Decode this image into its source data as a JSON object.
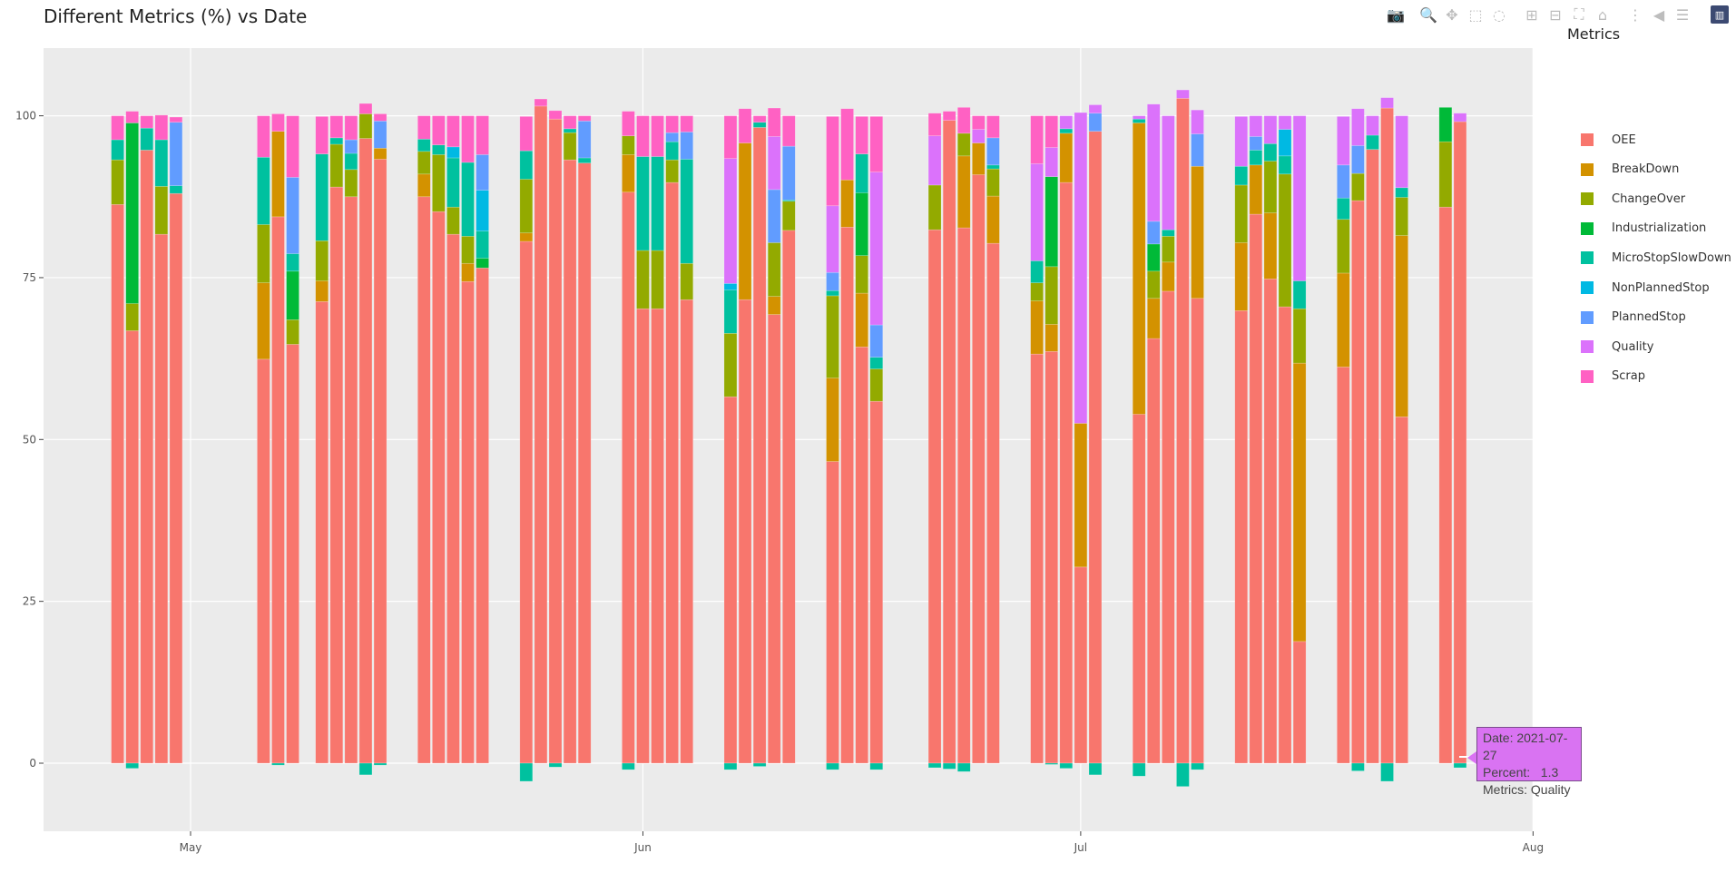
{
  "title": "Different Metrics (%) vs Date",
  "modebar": {
    "buttons": [
      {
        "icon": "camera-icon",
        "label": "Download plot as a png",
        "glyph": "📷"
      },
      {
        "icon": "zoom-icon",
        "label": "Zoom",
        "glyph": "🔍",
        "active": true
      },
      {
        "icon": "pan-icon",
        "label": "Pan",
        "glyph": "✥"
      },
      {
        "icon": "box-select-icon",
        "label": "Box Select",
        "glyph": "⬚"
      },
      {
        "icon": "lasso-select-icon",
        "label": "Lasso Select",
        "glyph": "◌"
      },
      {
        "icon": "zoom-in-icon",
        "label": "Zoom in",
        "glyph": "⊞"
      },
      {
        "icon": "zoom-out-icon",
        "label": "Zoom out",
        "glyph": "⊟"
      },
      {
        "icon": "autoscale-icon",
        "label": "Autoscale",
        "glyph": "⛶"
      },
      {
        "icon": "home-icon",
        "label": "Reset axes",
        "glyph": "⌂"
      },
      {
        "icon": "spike-lines-icon",
        "label": "Toggle Spike Lines",
        "glyph": "⋮"
      },
      {
        "icon": "hover-closest-icon",
        "label": "Show closest data on hover",
        "glyph": "◀"
      },
      {
        "icon": "hover-compare-icon",
        "label": "Compare data on hover",
        "glyph": "☰"
      }
    ],
    "logo": "plotly-logo-icon"
  },
  "tooltip": {
    "date_line": "Date: 2021-07-27",
    "percent_line": "Percent:   1.3",
    "metrics_line": "Metrics: Quality",
    "color": "#d973f2"
  },
  "chart_data": {
    "type": "bar",
    "barmode": "stacked",
    "title": "Different Metrics (%) vs Date",
    "xlabel": "",
    "ylabel": "",
    "x_range": [
      "2021-04-23",
      "2021-08-01"
    ],
    "ylim": [
      -10.5,
      110
    ],
    "x_ticks": [
      {
        "label": "May",
        "date": "2021-05-01"
      },
      {
        "label": "Jun",
        "date": "2021-06-01"
      },
      {
        "label": "Jul",
        "date": "2021-07-01"
      },
      {
        "label": "Aug",
        "date": "2021-08-01"
      }
    ],
    "y_ticks": [
      0,
      25,
      50,
      75,
      100
    ],
    "grid": true,
    "legend": {
      "title": "Metrics",
      "position": "right"
    },
    "series_order": [
      "OEE",
      "BreakDown",
      "ChangeOver",
      "Industrialization",
      "MicroStopSlowDown",
      "NonPlannedStop",
      "PlannedStop",
      "Quality",
      "Scrap"
    ],
    "colors": {
      "OEE": "#f8766d",
      "BreakDown": "#d39200",
      "ChangeOver": "#93aa00",
      "Industrialization": "#00ba38",
      "MicroStopSlowDown": "#00c19f",
      "NonPlannedStop": "#00b9e3",
      "PlannedStop": "#619cff",
      "Quality": "#db72fb",
      "Scrap": "#ff61c3"
    },
    "bars": [
      {
        "date": "2021-04-26",
        "OEE": 86.3,
        "ChangeOver": 6.9,
        "MicroStopSlowDown": 3.1,
        "Scrap": 3.7
      },
      {
        "date": "2021-04-27",
        "OEE": 66.8,
        "ChangeOver": 4.2,
        "Industrialization": 27.9,
        "Scrap": 1.8,
        "MicroStopSlowDown": -0.8
      },
      {
        "date": "2021-04-28",
        "OEE": 94.7,
        "MicroStopSlowDown": 3.4,
        "Scrap": 1.9
      },
      {
        "date": "2021-04-29",
        "OEE": 81.7,
        "ChangeOver": 7.4,
        "MicroStopSlowDown": 7.2,
        "Scrap": 3.8
      },
      {
        "date": "2021-04-30",
        "OEE": 88.0,
        "MicroStopSlowDown": 1.2,
        "PlannedStop": 9.8,
        "Scrap": 0.8
      },
      {
        "date": "2021-05-06",
        "OEE": 62.4,
        "BreakDown": 11.8,
        "ChangeOver": 9.0,
        "MicroStopSlowDown": 10.4,
        "Scrap": 6.4
      },
      {
        "date": "2021-05-07",
        "OEE": 84.4,
        "BreakDown": 13.2,
        "Scrap": 2.7,
        "MicroStopSlowDown": -0.3
      },
      {
        "date": "2021-05-08",
        "OEE": 64.7,
        "ChangeOver": 3.8,
        "Industrialization": 7.5,
        "MicroStopSlowDown": 2.7,
        "PlannedStop": 11.8,
        "Scrap": 9.5
      },
      {
        "date": "2021-05-10",
        "OEE": 71.3,
        "BreakDown": 3.2,
        "ChangeOver": 6.2,
        "MicroStopSlowDown": 13.4,
        "Scrap": 5.8
      },
      {
        "date": "2021-05-11",
        "OEE": 89.0,
        "ChangeOver": 6.6,
        "MicroStopSlowDown": 1.0,
        "Scrap": 3.4
      },
      {
        "date": "2021-05-12",
        "OEE": 87.5,
        "ChangeOver": 4.2,
        "MicroStopSlowDown": 2.5,
        "PlannedStop": 2.1,
        "Scrap": 3.7
      },
      {
        "date": "2021-05-13",
        "OEE": 96.5,
        "ChangeOver": 3.8,
        "Scrap": 1.6,
        "MicroStopSlowDown": -1.8
      },
      {
        "date": "2021-05-14",
        "OEE": 93.3,
        "BreakDown": 1.7,
        "PlannedStop": 4.2,
        "Scrap": 1.1,
        "MicroStopSlowDown": -0.3
      },
      {
        "date": "2021-05-17",
        "OEE": 87.5,
        "BreakDown": 3.5,
        "ChangeOver": 3.5,
        "MicroStopSlowDown": 1.9,
        "Scrap": 3.6
      },
      {
        "date": "2021-05-18",
        "OEE": 85.2,
        "ChangeOver": 8.8,
        "MicroStopSlowDown": 1.5,
        "Scrap": 4.5
      },
      {
        "date": "2021-05-19",
        "OEE": 81.7,
        "ChangeOver": 4.2,
        "MicroStopSlowDown": 7.6,
        "NonPlannedStop": 1.7,
        "Scrap": 4.8
      },
      {
        "date": "2021-05-20",
        "OEE": 74.4,
        "BreakDown": 2.8,
        "ChangeOver": 4.2,
        "MicroStopSlowDown": 11.4,
        "Scrap": 7.2
      },
      {
        "date": "2021-05-21",
        "OEE": 76.5,
        "Industrialization": 1.5,
        "MicroStopSlowDown": 4.2,
        "NonPlannedStop": 6.3,
        "PlannedStop": 5.5,
        "Scrap": 6.0
      },
      {
        "date": "2021-05-24",
        "OEE": 80.6,
        "BreakDown": 1.3,
        "ChangeOver": 8.3,
        "MicroStopSlowDown": 4.4,
        "Scrap": 5.3,
        "MicroStopSlowDown_neg": -2.8
      },
      {
        "date": "2021-05-25",
        "OEE": 101.5,
        "Scrap": 1.1
      },
      {
        "date": "2021-05-26",
        "OEE": 99.5,
        "Scrap": 1.3,
        "MicroStopSlowDown": -0.6
      },
      {
        "date": "2021-05-27",
        "OEE": 93.2,
        "ChangeOver": 4.2,
        "MicroStopSlowDown": 0.6,
        "Scrap": 2.0
      },
      {
        "date": "2021-05-28",
        "OEE": 92.7,
        "MicroStopSlowDown": 0.8,
        "PlannedStop": 5.7,
        "Scrap": 0.8
      },
      {
        "date": "2021-05-31",
        "OEE": 88.2,
        "BreakDown": 5.8,
        "ChangeOver": 2.9,
        "Scrap": 3.8,
        "MicroStopSlowDown": -1.0
      },
      {
        "date": "2021-06-01",
        "OEE": 70.2,
        "ChangeOver": 9.0,
        "MicroStopSlowDown": 14.5,
        "Scrap": 6.3
      },
      {
        "date": "2021-06-02",
        "OEE": 70.2,
        "ChangeOver": 9.0,
        "MicroStopSlowDown": 14.5,
        "Scrap": 6.3
      },
      {
        "date": "2021-06-03",
        "OEE": 89.7,
        "ChangeOver": 3.5,
        "MicroStopSlowDown": 2.8,
        "PlannedStop": 1.4,
        "Scrap": 2.6
      },
      {
        "date": "2021-06-04",
        "OEE": 71.6,
        "ChangeOver": 5.6,
        "MicroStopSlowDown": 16.1,
        "PlannedStop": 4.2,
        "Scrap": 2.5
      },
      {
        "date": "2021-06-07",
        "OEE": 56.6,
        "ChangeOver": 9.8,
        "MicroStopSlowDown": 6.7,
        "NonPlannedStop": 1.0,
        "Quality": 19.3,
        "Scrap": 6.6,
        "MicroStopSlowDown_neg": -1.0
      },
      {
        "date": "2021-06-08",
        "OEE": 71.6,
        "BreakDown": 24.2,
        "Scrap": 5.3
      },
      {
        "date": "2021-06-09",
        "OEE": 98.2,
        "MicroStopSlowDown": 0.8,
        "Scrap": 1.0,
        "MicroStopSlowDown_neg": -0.5
      },
      {
        "date": "2021-06-10",
        "OEE": 69.3,
        "BreakDown": 2.8,
        "ChangeOver": 8.3,
        "PlannedStop": 8.2,
        "Quality": 8.2,
        "Scrap": 4.4
      },
      {
        "date": "2021-06-11",
        "OEE": 82.3,
        "ChangeOver": 4.5,
        "MicroStopSlowDown": 0.2,
        "PlannedStop": 8.3,
        "Scrap": 4.7
      },
      {
        "date": "2021-06-14",
        "OEE": 46.6,
        "BreakDown": 12.9,
        "ChangeOver": 12.7,
        "MicroStopSlowDown": 0.8,
        "PlannedStop": 2.8,
        "Quality": 10.3,
        "Scrap": 13.8,
        "MicroStopSlowDown_neg": -1.0
      },
      {
        "date": "2021-06-15",
        "OEE": 82.8,
        "BreakDown": 7.3,
        "Scrap": 11.0
      },
      {
        "date": "2021-06-16",
        "OEE": 64.3,
        "BreakDown": 8.3,
        "ChangeOver": 5.8,
        "Industrialization": 9.7,
        "MicroStopSlowDown": 6.0,
        "Scrap": 5.8
      },
      {
        "date": "2021-06-17",
        "OEE": 55.9,
        "ChangeOver": 5.0,
        "MicroStopSlowDown": 1.8,
        "PlannedStop": 5.0,
        "Quality": 23.6,
        "Scrap": 8.6,
        "MicroStopSlowDown_neg": -1.0
      },
      {
        "date": "2021-06-21",
        "OEE": 82.4,
        "ChangeOver": 6.9,
        "Quality": 7.6,
        "Scrap": 3.5,
        "MicroStopSlowDown": -0.7
      },
      {
        "date": "2021-06-22",
        "OEE": 99.3,
        "Scrap": 1.4,
        "MicroStopSlowDown": -0.9
      },
      {
        "date": "2021-06-23",
        "OEE": 82.7,
        "BreakDown": 11.1,
        "ChangeOver": 3.5,
        "Scrap": 4.0,
        "MicroStopSlowDown": -1.3
      },
      {
        "date": "2021-06-24",
        "OEE": 90.9,
        "BreakDown": 4.9,
        "Quality": 2.1,
        "Scrap": 2.1
      },
      {
        "date": "2021-06-25",
        "OEE": 80.3,
        "BreakDown": 7.3,
        "ChangeOver": 4.2,
        "MicroStopSlowDown": 0.6,
        "PlannedStop": 4.2,
        "Scrap": 3.4
      },
      {
        "date": "2021-06-28",
        "OEE": 63.2,
        "BreakDown": 8.2,
        "ChangeOver": 2.8,
        "MicroStopSlowDown": 3.4,
        "Quality": 15.0,
        "Scrap": 7.4
      },
      {
        "date": "2021-06-29",
        "OEE": 63.6,
        "BreakDown": 4.2,
        "ChangeOver": 8.9,
        "Industrialization": 13.9,
        "Quality": 4.5,
        "Scrap": 4.9,
        "MicroStopSlowDown": -0.2
      },
      {
        "date": "2021-06-30",
        "OEE": 89.7,
        "BreakDown": 7.6,
        "MicroStopSlowDown": 0.7,
        "Quality": 2.0,
        "MicroStopSlowDown_neg": -0.8
      },
      {
        "date": "2021-07-01",
        "OEE": 30.3,
        "BreakDown": 22.2,
        "Quality": 48.0
      },
      {
        "date": "2021-07-02",
        "OEE": 97.6,
        "PlannedStop": 2.8,
        "Quality": 1.3,
        "MicroStopSlowDown": -1.8
      },
      {
        "date": "2021-07-05",
        "OEE": 53.9,
        "BreakDown": 45.0,
        "MicroStopSlowDown": 0.6,
        "Quality": 0.5,
        "MicroStopSlowDown_neg": -2.0
      },
      {
        "date": "2021-07-06",
        "OEE": 65.6,
        "BreakDown": 6.2,
        "ChangeOver": 4.2,
        "Industrialization": 4.2,
        "PlannedStop": 3.5,
        "Quality": 18.1
      },
      {
        "date": "2021-07-07",
        "OEE": 72.9,
        "BreakDown": 4.5,
        "ChangeOver": 4.0,
        "MicroStopSlowDown": 1.0,
        "Quality": 17.6
      },
      {
        "date": "2021-07-08",
        "OEE": 102.7,
        "Quality": 1.3,
        "MicroStopSlowDown": -3.6
      },
      {
        "date": "2021-07-09",
        "OEE": 71.8,
        "BreakDown": 20.4,
        "PlannedStop": 5.0,
        "Quality": 3.7,
        "MicroStopSlowDown": -1.0
      },
      {
        "date": "2021-07-12",
        "OEE": 69.9,
        "BreakDown": 10.5,
        "ChangeOver": 8.9,
        "MicroStopSlowDown": 2.9,
        "Quality": 7.7
      },
      {
        "date": "2021-07-13",
        "OEE": 84.8,
        "BreakDown": 7.6,
        "MicroStopSlowDown": 2.3,
        "PlannedStop": 2.1,
        "Quality": 3.2
      },
      {
        "date": "2021-07-14",
        "OEE": 74.8,
        "BreakDown": 10.2,
        "ChangeOver": 8.0,
        "MicroStopSlowDown": 2.7,
        "Quality": 4.3
      },
      {
        "date": "2021-07-15",
        "OEE": 70.5,
        "ChangeOver": 20.5,
        "MicroStopSlowDown": 2.8,
        "NonPlannedStop": 4.1,
        "Quality": 2.1
      },
      {
        "date": "2021-07-16",
        "OEE": 18.8,
        "BreakDown": 43.0,
        "ChangeOver": 8.4,
        "MicroStopSlowDown": 4.3,
        "Quality": 25.5
      },
      {
        "date": "2021-07-19",
        "OEE": 61.2,
        "BreakDown": 14.5,
        "ChangeOver": 8.3,
        "MicroStopSlowDown": 3.3,
        "PlannedStop": 5.1,
        "Quality": 7.5
      },
      {
        "date": "2021-07-20",
        "OEE": 86.9,
        "ChangeOver": 4.2,
        "PlannedStop": 4.3,
        "Quality": 5.7,
        "MicroStopSlowDown": -1.2
      },
      {
        "date": "2021-07-21",
        "OEE": 94.8,
        "MicroStopSlowDown": 2.2,
        "Quality": 3.0
      },
      {
        "date": "2021-07-22",
        "OEE": 101.2,
        "Quality": 1.6,
        "MicroStopSlowDown": -2.8
      },
      {
        "date": "2021-07-23",
        "OEE": 53.5,
        "BreakDown": 28.0,
        "ChangeOver": 5.9,
        "MicroStopSlowDown": 1.5,
        "Quality": 11.1
      },
      {
        "date": "2021-07-26",
        "OEE": 85.9,
        "ChangeOver": 10.1,
        "Industrialization": 5.3
      },
      {
        "date": "2021-07-27",
        "OEE": 99.1,
        "Quality": 1.3,
        "MicroStopSlowDown": -0.7
      }
    ]
  }
}
